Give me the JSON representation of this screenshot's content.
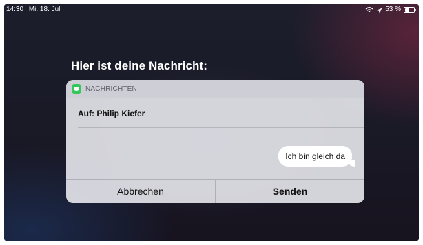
{
  "statusbar": {
    "time": "14:30",
    "date": "Mi. 18. Juli",
    "battery_percent": "53 %",
    "battery_level": 0.53,
    "icons": [
      "wifi-icon",
      "location-arrow-icon",
      "battery-icon"
    ]
  },
  "siri": {
    "prompt": "Hier ist deine Nachricht:"
  },
  "card": {
    "app_name": "NACHRICHTEN",
    "app_icon": "messages-icon",
    "app_icon_color": "#34C759",
    "recipient": "Auf: Philip Kiefer",
    "message_text": "Ich bin gleich da",
    "cancel_label": "Abbrechen",
    "send_label": "Senden"
  }
}
